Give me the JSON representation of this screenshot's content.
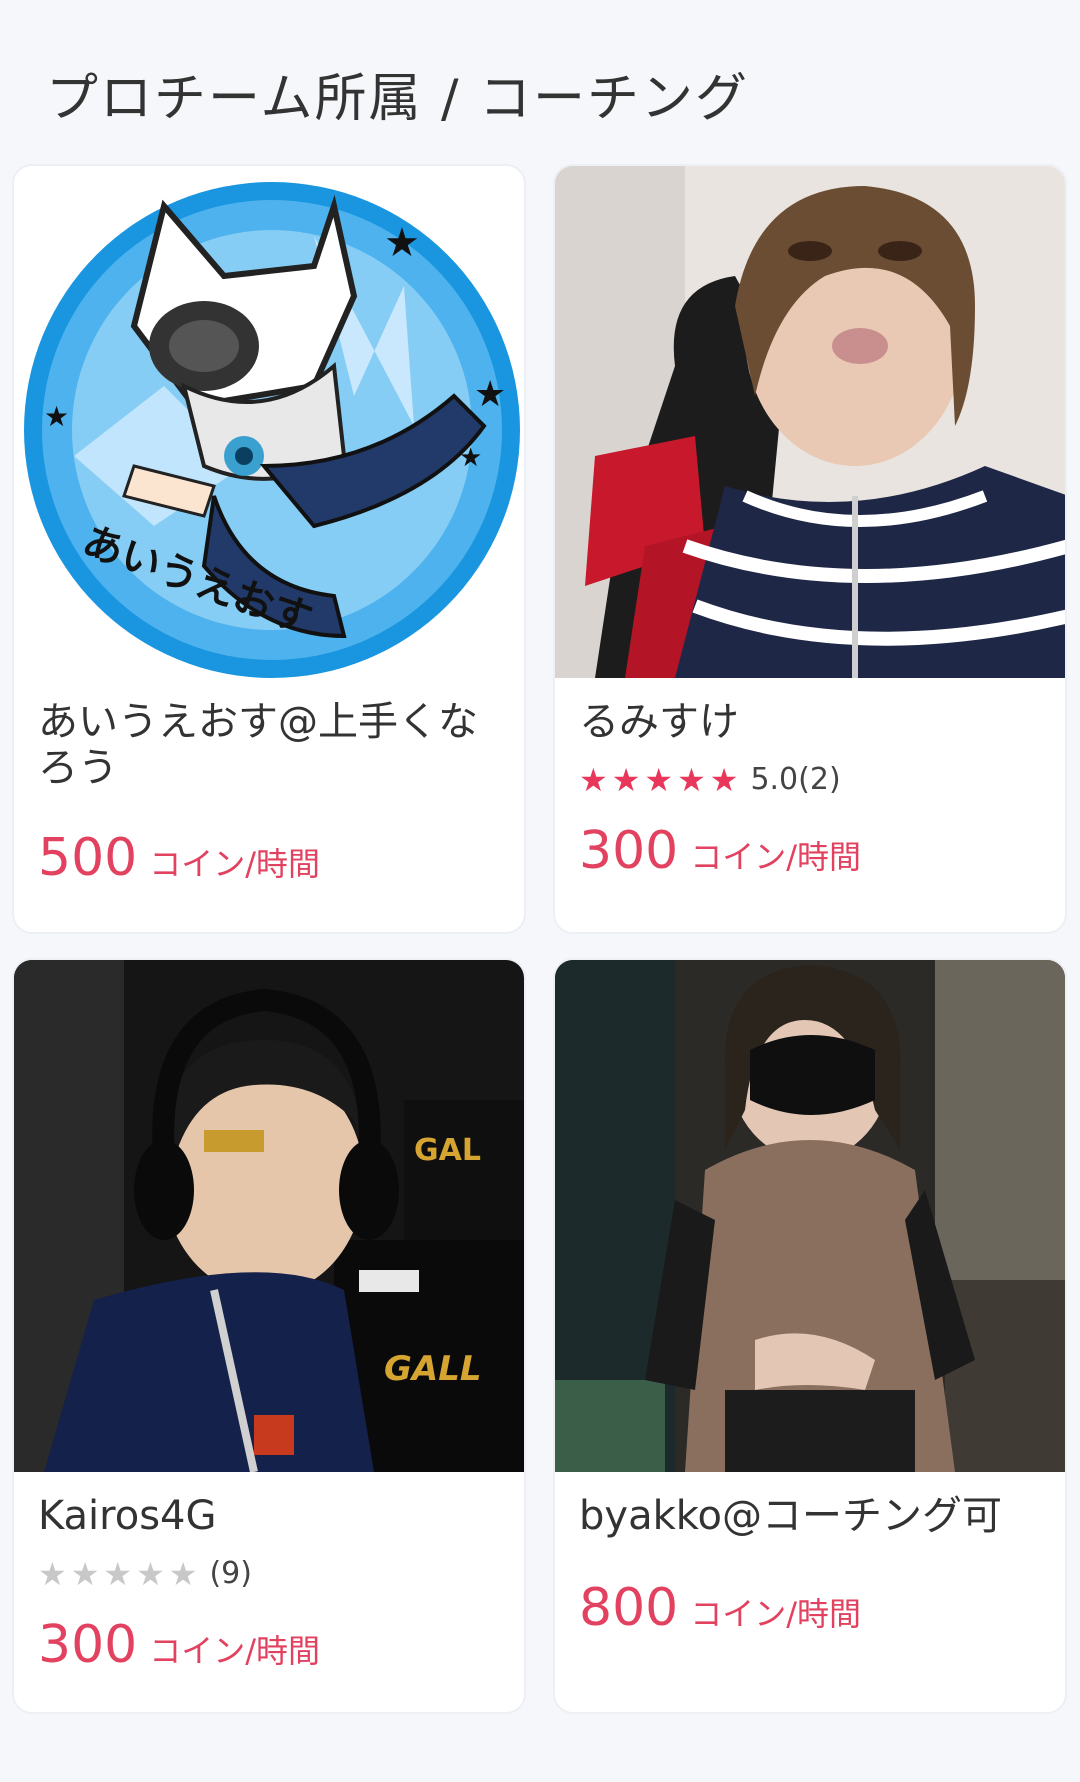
{
  "section": {
    "title": "プロチーム所属 / コーチング"
  },
  "cards": [
    {
      "name": "あいうえおす@上手くなろう",
      "rating": null,
      "review_count": null,
      "price": "500",
      "price_unit": "コイン/時間",
      "avatar_text": "あいうえおす"
    },
    {
      "name": "るみすけ",
      "rating_text": "5.0(2)",
      "stars_filled": 5,
      "price": "300",
      "price_unit": "コイン/時間"
    },
    {
      "name": "Kairos4G",
      "rating_text": "(9)",
      "stars_filled": 0,
      "price": "300",
      "price_unit": "コイン/時間"
    },
    {
      "name": "byakko@コーチング可",
      "price": "800",
      "price_unit": "コイン/時間"
    }
  ],
  "star_glyph": "★",
  "colors": {
    "accent": "#e2425f",
    "star_on": "#e8375a",
    "star_off": "#c8c8c8"
  }
}
